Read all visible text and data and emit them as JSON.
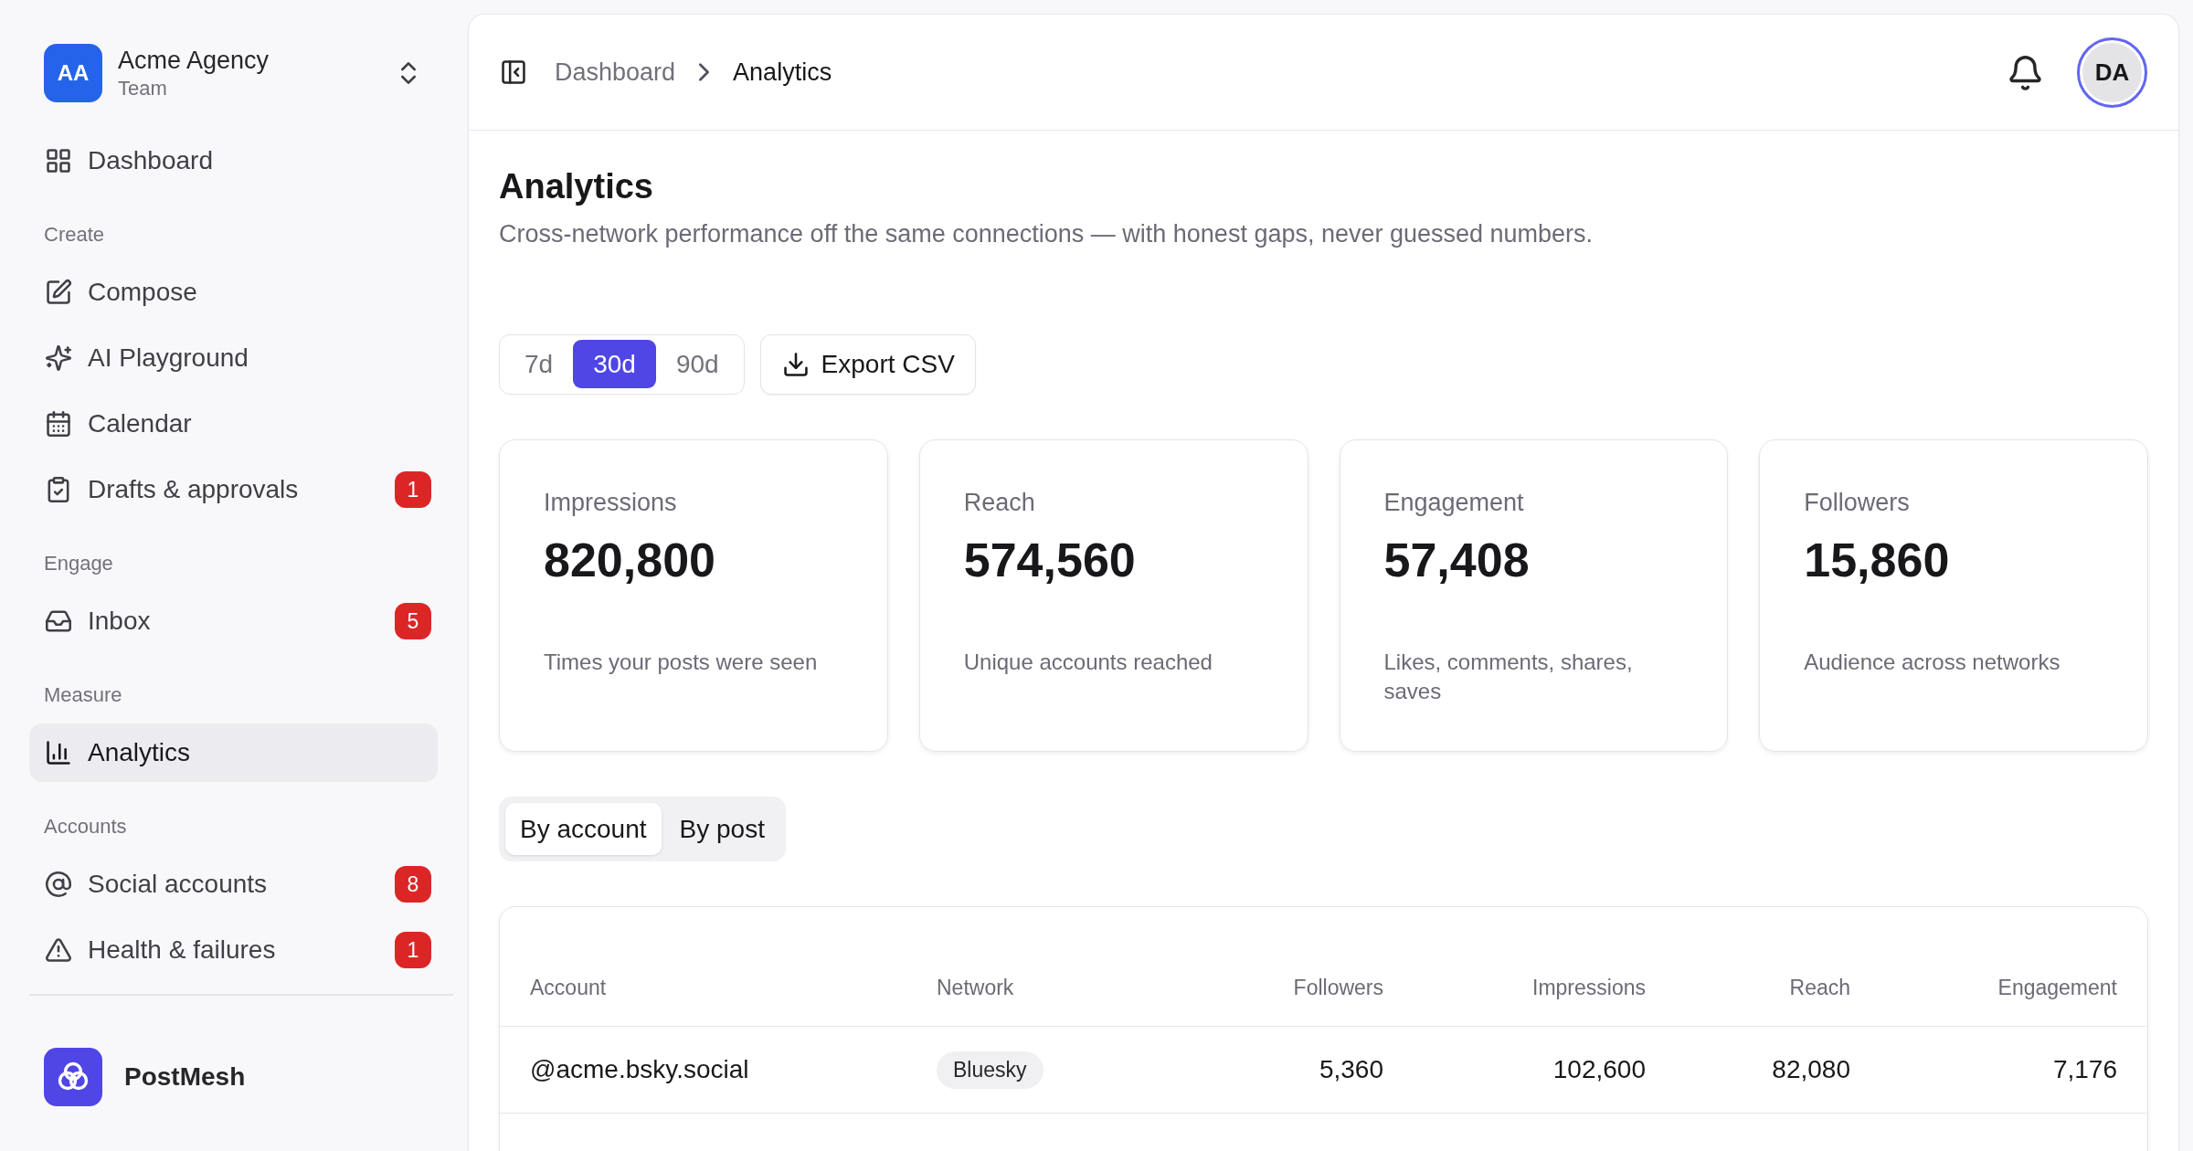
{
  "sidebar": {
    "workspace": {
      "initials": "AA",
      "name": "Acme Agency",
      "plan": "Team"
    },
    "sections": [
      {
        "items": [
          {
            "label": "Dashboard",
            "selected": false
          }
        ]
      },
      {
        "title": "Create",
        "items": [
          {
            "label": "Compose",
            "selected": false
          },
          {
            "label": "AI Playground",
            "selected": false
          },
          {
            "label": "Calendar",
            "selected": false
          },
          {
            "label": "Drafts & approvals",
            "selected": false,
            "badge": "1"
          }
        ]
      },
      {
        "title": "Engage",
        "items": [
          {
            "label": "Inbox",
            "selected": false,
            "badge": "5"
          }
        ]
      },
      {
        "title": "Measure",
        "items": [
          {
            "label": "Analytics",
            "selected": true
          }
        ]
      },
      {
        "title": "Accounts",
        "items": [
          {
            "label": "Social accounts",
            "selected": false,
            "badge": "8"
          },
          {
            "label": "Health & failures",
            "selected": false,
            "badge": "1"
          }
        ]
      }
    ],
    "brand": {
      "name": "PostMesh"
    }
  },
  "header": {
    "breadcrumbs": [
      "Dashboard",
      "Analytics"
    ],
    "user_initials": "DA"
  },
  "page": {
    "title": "Analytics",
    "subtitle": "Cross-network performance off the same connections — with honest gaps, never guessed numbers."
  },
  "range_options": [
    {
      "label": "7d",
      "selected": false
    },
    {
      "label": "30d",
      "selected": true
    },
    {
      "label": "90d",
      "selected": false
    }
  ],
  "export_button": "Export CSV",
  "stats": [
    {
      "label": "Impressions",
      "value": "820,800",
      "description": "Times your posts were seen"
    },
    {
      "label": "Reach",
      "value": "574,560",
      "description": "Unique accounts reached"
    },
    {
      "label": "Engagement",
      "value": "57,408",
      "description": "Likes, comments, shares, saves"
    },
    {
      "label": "Followers",
      "value": "15,860",
      "description": "Audience across networks"
    }
  ],
  "view_tabs": [
    {
      "label": "By account",
      "selected": true
    },
    {
      "label": "By post",
      "selected": false
    }
  ],
  "table": {
    "columns": [
      "Account",
      "Network",
      "Followers",
      "Impressions",
      "Reach",
      "Engagement"
    ],
    "rows": [
      [
        "@acme.bsky.social",
        "Bluesky",
        "5,360",
        "102,600",
        "82,080",
        "7,176"
      ]
    ]
  }
}
